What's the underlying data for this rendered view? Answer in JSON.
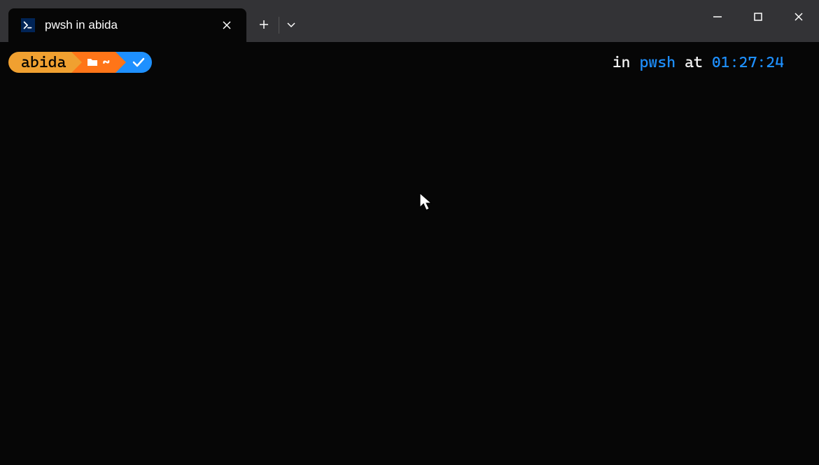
{
  "titlebar": {
    "tab": {
      "title": "pwsh in abida"
    }
  },
  "prompt": {
    "user": "abida",
    "path": "~",
    "right": {
      "in": "in",
      "shell": "pwsh",
      "at": "at",
      "time": "01:27:24"
    }
  }
}
